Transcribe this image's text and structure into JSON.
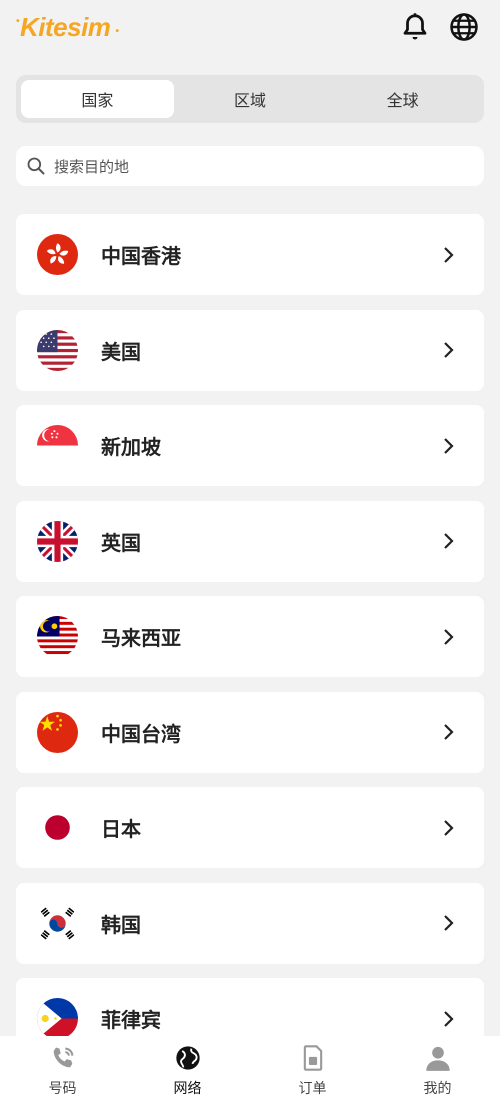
{
  "app": {
    "logo_text": "Kitesim"
  },
  "header": {
    "bell_icon": "bell-icon",
    "language_icon": "globe-icon"
  },
  "segment": {
    "tabs": [
      {
        "label": "国家",
        "active": true
      },
      {
        "label": "区域",
        "active": false
      },
      {
        "label": "全球",
        "active": false
      }
    ]
  },
  "search": {
    "placeholder": "搜索目的地"
  },
  "countries": [
    {
      "name": "中国香港",
      "flag": "hong-kong-flag-icon"
    },
    {
      "name": "美国",
      "flag": "usa-flag-icon"
    },
    {
      "name": "新加坡",
      "flag": "singapore-flag-icon"
    },
    {
      "name": "英国",
      "flag": "uk-flag-icon"
    },
    {
      "name": "马来西亚",
      "flag": "malaysia-flag-icon"
    },
    {
      "name": "中国台湾",
      "flag": "taiwan-flag-icon"
    },
    {
      "name": "日本",
      "flag": "japan-flag-icon"
    },
    {
      "name": "韩国",
      "flag": "south-korea-flag-icon"
    },
    {
      "name": "菲律宾",
      "flag": "philippines-flag-icon"
    }
  ],
  "tabbar": {
    "items": [
      {
        "label": "号码",
        "icon": "phone-icon"
      },
      {
        "label": "网络",
        "icon": "globe-icon",
        "active": true
      },
      {
        "label": "订单",
        "icon": "sim-card-icon"
      },
      {
        "label": "我的",
        "icon": "person-icon"
      }
    ]
  },
  "colors": {
    "brand": "#f5a623",
    "background": "#f2f2f2",
    "card": "#ffffff"
  }
}
